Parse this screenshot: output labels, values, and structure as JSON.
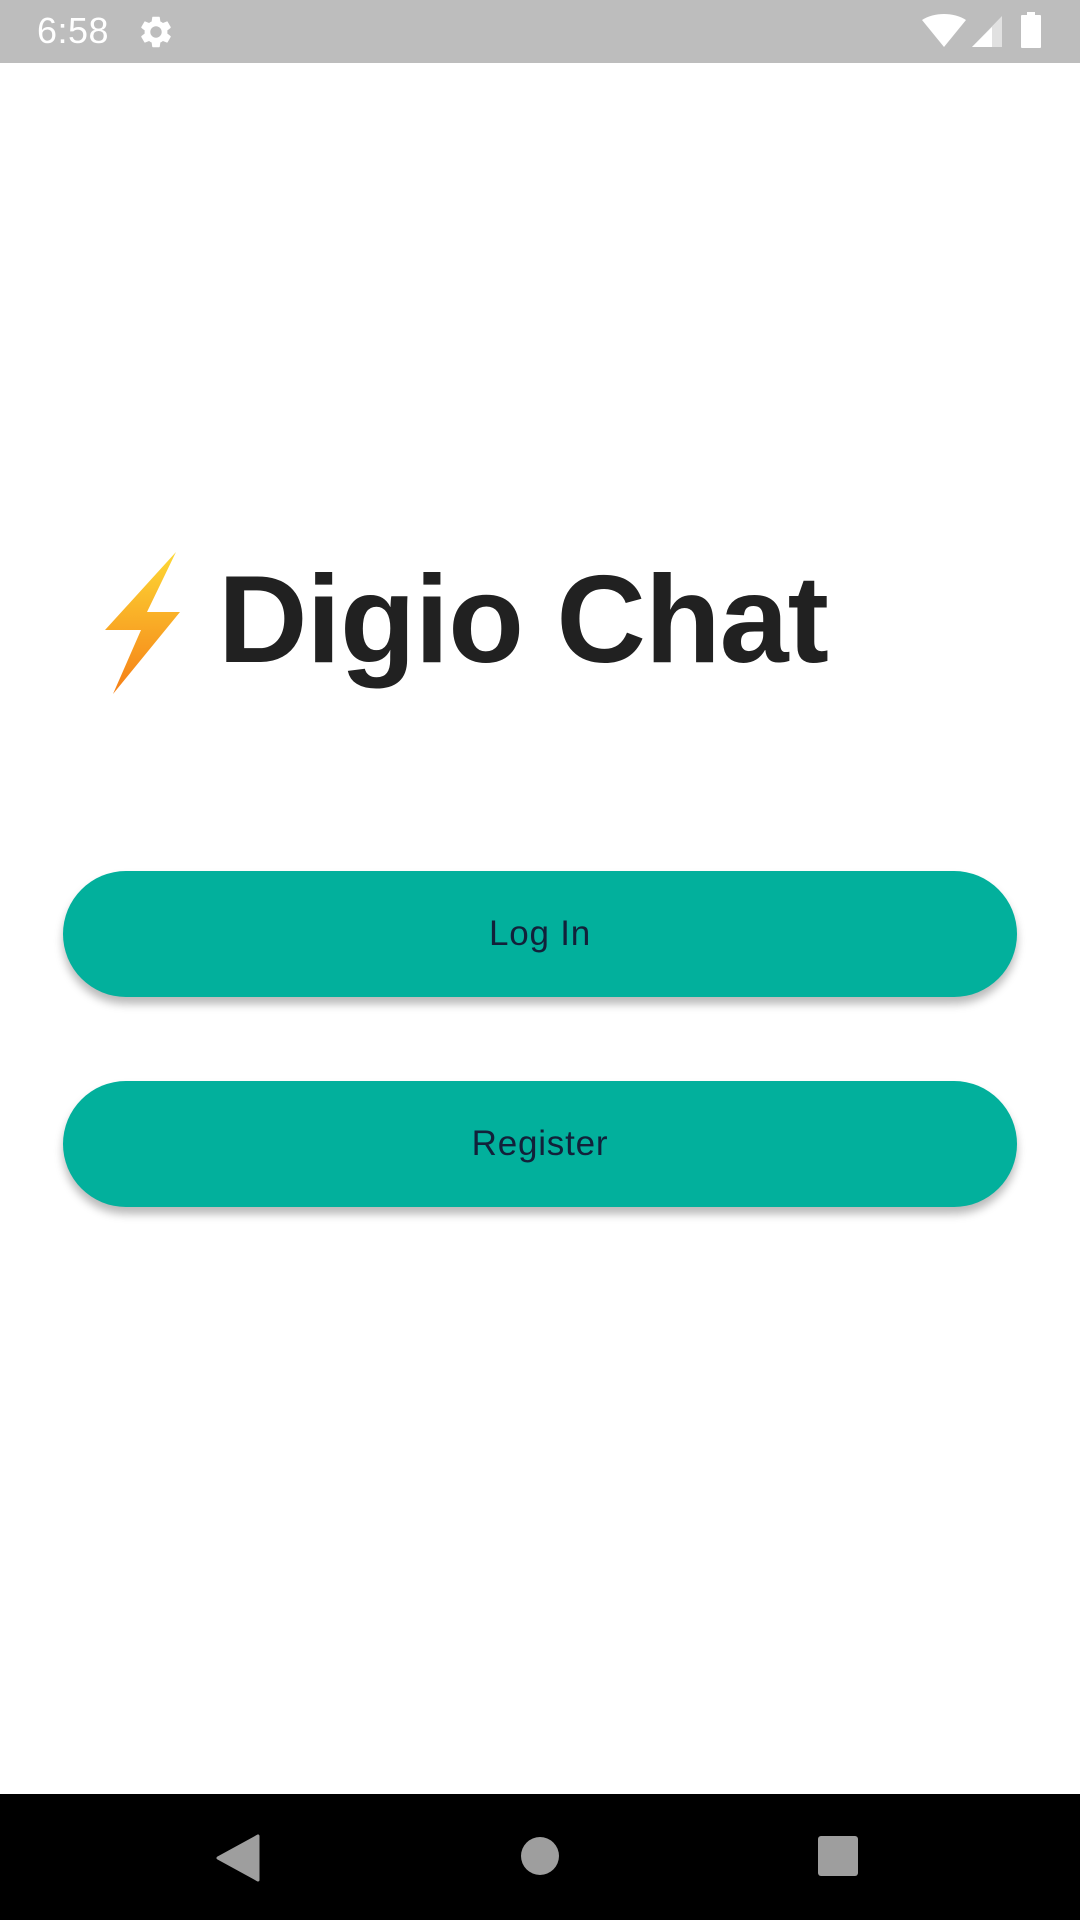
{
  "status_bar": {
    "time": "6:58",
    "icons": [
      "settings-gear-icon",
      "wifi-icon",
      "cell-signal-icon",
      "battery-icon"
    ]
  },
  "app": {
    "title": "Digio Chat",
    "logo_icon": "lightning-bolt-icon"
  },
  "buttons": {
    "login_label": "Log In",
    "register_label": "Register"
  },
  "navigation": {
    "icons": [
      "back-icon",
      "home-icon",
      "recents-icon"
    ]
  },
  "colors": {
    "accent": "#02b09c",
    "status_bar": "#bdbdbd",
    "title_text": "#212121",
    "button_text": "#12213a",
    "bolt_top": "#fdd835",
    "bolt_bottom": "#f57f17"
  }
}
